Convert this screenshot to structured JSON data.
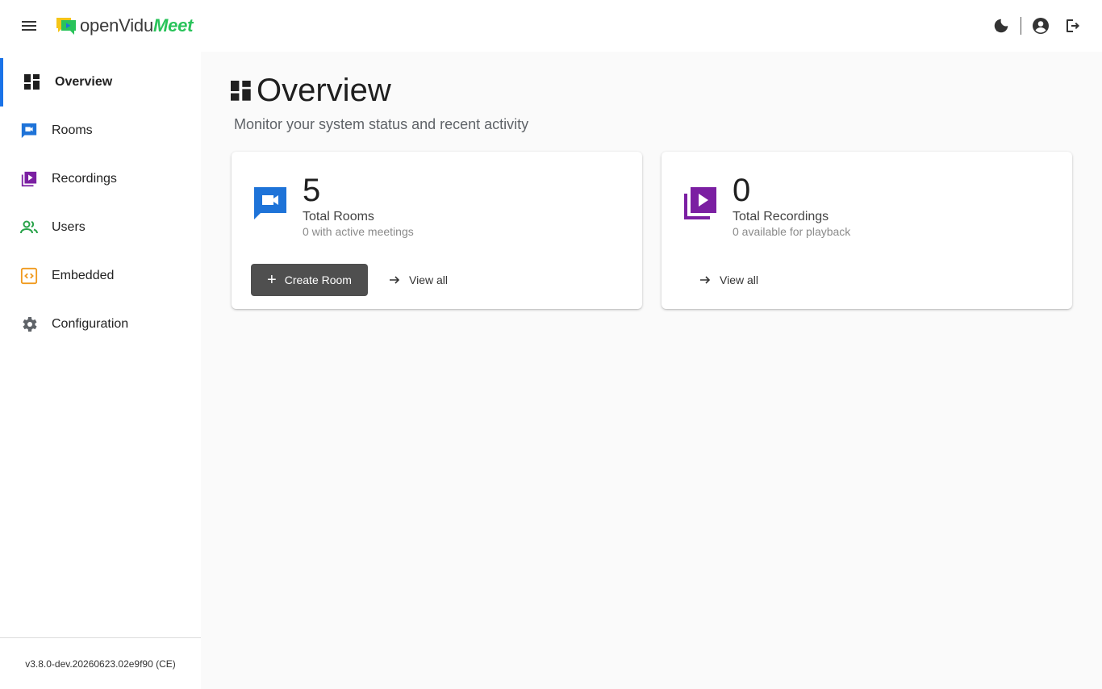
{
  "header": {
    "logo_part1": "openVidu",
    "logo_part2": "Meet",
    "menu_icon": "hamburger-icon",
    "actions": [
      "theme-toggle-icon",
      "account-icon",
      "logout-icon"
    ]
  },
  "sidebar": {
    "items": [
      {
        "label": "Overview",
        "icon": "dashboard-icon",
        "color": "#1f1f1f"
      },
      {
        "label": "Rooms",
        "icon": "video-chat-icon",
        "color": "#1e73d8"
      },
      {
        "label": "Recordings",
        "icon": "video-library-icon",
        "color": "#7b1fa2"
      },
      {
        "label": "Users",
        "icon": "users-icon",
        "color": "#29a34a"
      },
      {
        "label": "Embedded",
        "icon": "code-icon",
        "color": "#f09a1e"
      },
      {
        "label": "Configuration",
        "icon": "gear-icon",
        "color": "#5f6368"
      }
    ],
    "version": "v3.8.0-dev.20260623.02e9f90 (CE)"
  },
  "main": {
    "title": "Overview",
    "subtitle": "Monitor your system status and recent activity",
    "cards": [
      {
        "count": "5",
        "label": "Total Rooms",
        "sub": "0 with active meetings",
        "primary_button": "Create Room",
        "link": "View all",
        "icon_color": "#1e73d8"
      },
      {
        "count": "0",
        "label": "Total Recordings",
        "sub": "0 available for playback",
        "link": "View all",
        "icon_color": "#7b1fa2"
      }
    ]
  }
}
